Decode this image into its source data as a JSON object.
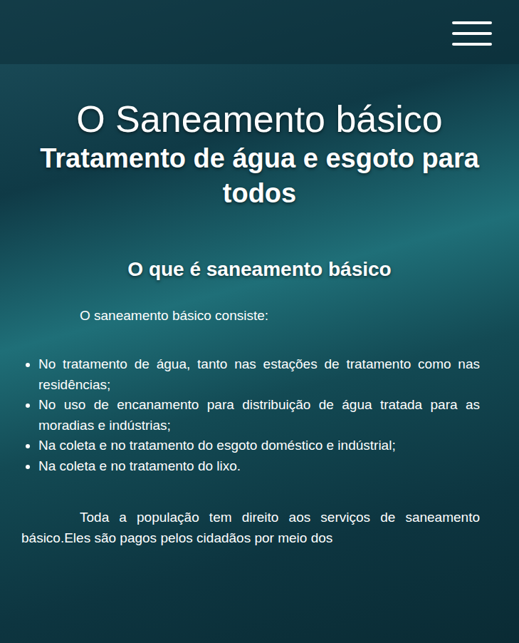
{
  "page": {
    "title": "O Saneamento básico",
    "subtitle": "Tratamento de água e esgoto para todos"
  },
  "section": {
    "heading": "O que é saneamento básico",
    "intro": "O saneamento básico consiste:",
    "items": [
      "No tratamento de água, tanto nas estações de tratamento como nas residências;",
      "No uso de encanamento para distribuição de água tratada para as moradias e indústrias;",
      "Na coleta e no tratamento do esgoto doméstico e indústrial;",
      "Na coleta e no tratamento do lixo."
    ],
    "paragraph": "Toda a população tem direito aos serviços de saneamento básico.Eles são pagos pelos cidadãos por meio dos"
  }
}
